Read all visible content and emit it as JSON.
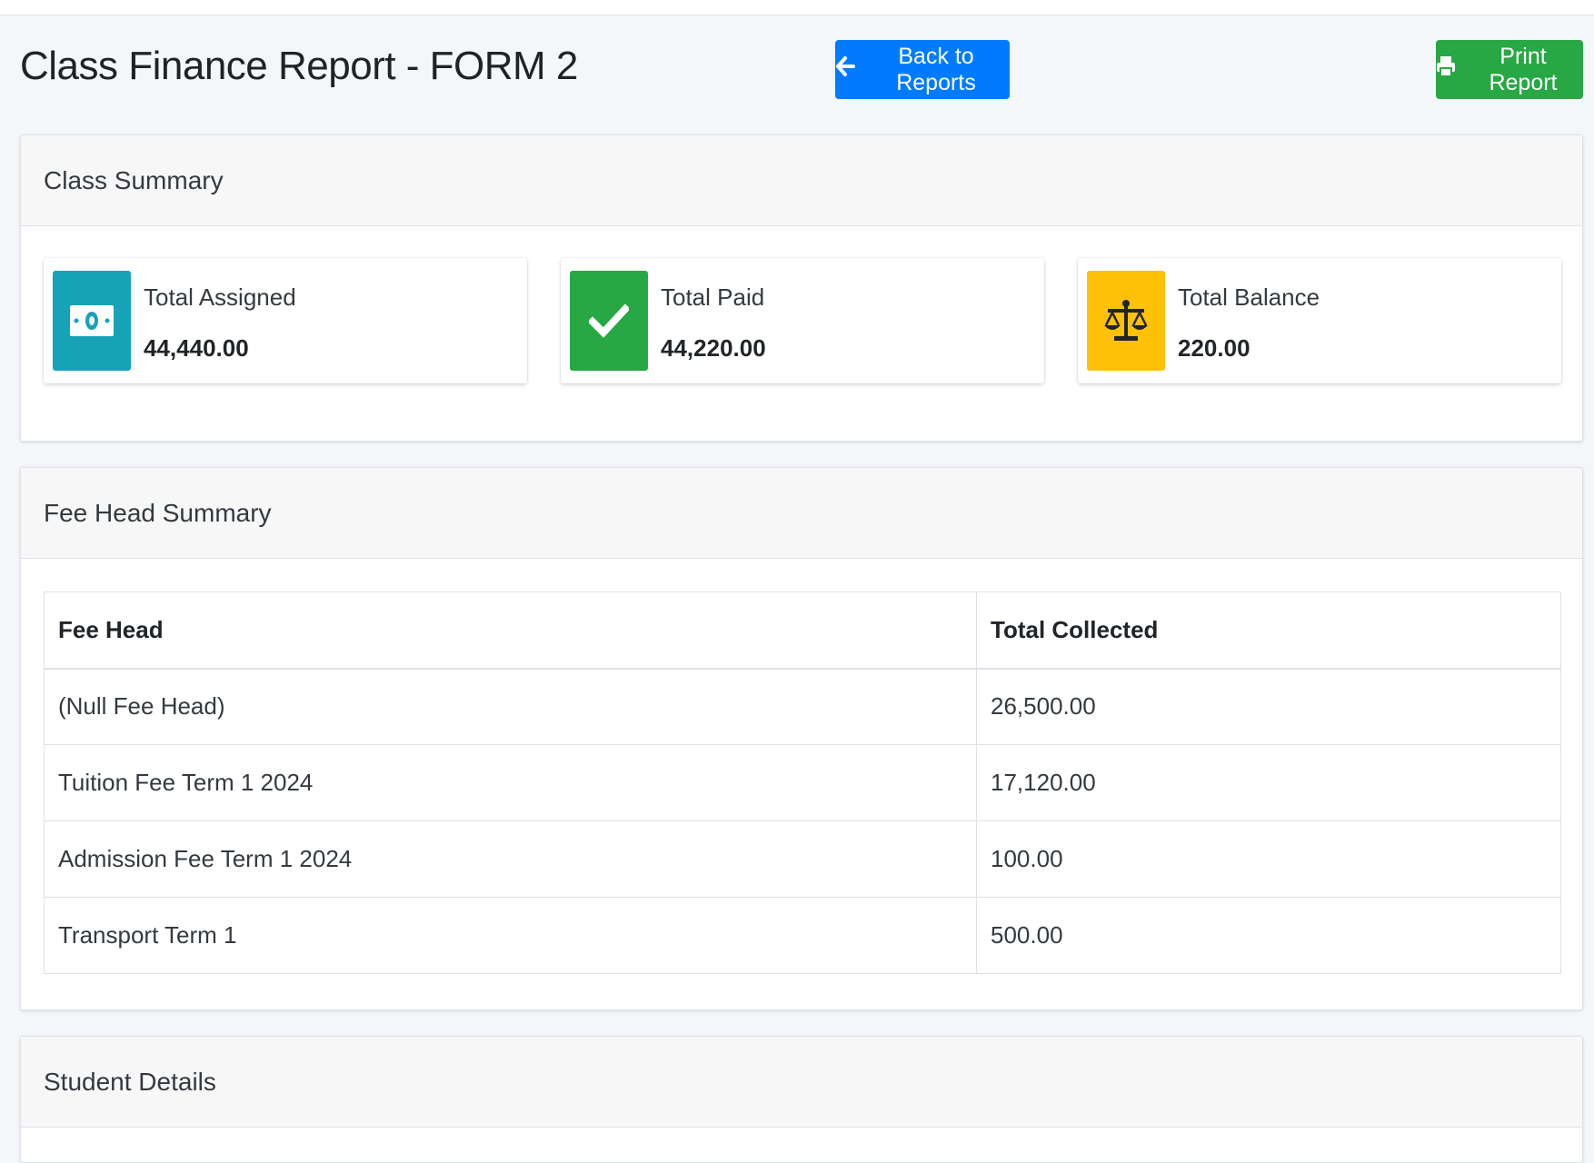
{
  "header": {
    "title": "Class Finance Report - FORM 2",
    "back_label": "Back to Reports",
    "print_label": "Print Report"
  },
  "summary": {
    "title": "Class Summary",
    "boxes": [
      {
        "label": "Total Assigned",
        "value": "44,440.00",
        "icon": "money-bill-icon",
        "color": "#17a2b8"
      },
      {
        "label": "Total Paid",
        "value": "44,220.00",
        "icon": "check-icon",
        "color": "#28a745"
      },
      {
        "label": "Total Balance",
        "value": "220.00",
        "icon": "balance-scale-icon",
        "color": "#ffc107"
      }
    ]
  },
  "fee_heads": {
    "title": "Fee Head Summary",
    "columns": [
      "Fee Head",
      "Total Collected"
    ],
    "rows": [
      [
        "(Null Fee Head)",
        "26,500.00"
      ],
      [
        "Tuition Fee Term 1 2024",
        "17,120.00"
      ],
      [
        "Admission Fee Term 1 2024",
        "100.00"
      ],
      [
        "Transport Term 1",
        "500.00"
      ]
    ]
  },
  "students": {
    "title": "Student Details"
  },
  "colors": {
    "primary": "#007bff",
    "success": "#28a745",
    "info": "#17a2b8",
    "warning": "#ffc107"
  }
}
